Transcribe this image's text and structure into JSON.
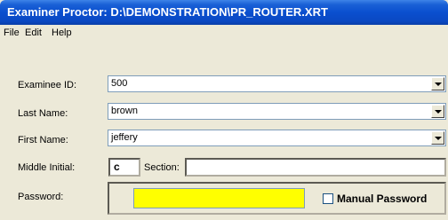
{
  "window": {
    "title": "Examiner Proctor: D:\\DEMONSTRATION\\PR_ROUTER.XRT"
  },
  "menu": {
    "file": "File",
    "edit": "Edit",
    "help": "Help"
  },
  "form": {
    "examinee_id": {
      "label": "Examinee ID:",
      "value": "500"
    },
    "last_name": {
      "label": "Last Name:",
      "value": "brown"
    },
    "first_name": {
      "label": "First Name:",
      "value": "jeffery"
    },
    "middle_initial": {
      "label": "Middle Initial:",
      "value": "c"
    },
    "section": {
      "label": "Section:",
      "value": ""
    },
    "password": {
      "label": "Password:",
      "value": ""
    },
    "manual_password": {
      "label": "Manual Password",
      "checked": false
    }
  },
  "colors": {
    "password_bg": "#ffff00",
    "titlebar": "#0a4fcf"
  }
}
